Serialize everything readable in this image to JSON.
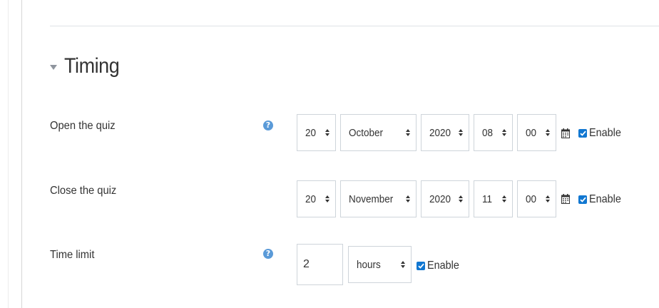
{
  "section": {
    "title": "Timing"
  },
  "open": {
    "label": "Open the quiz",
    "day": "20",
    "month": "October",
    "year": "2020",
    "hour": "08",
    "minute": "00",
    "enable_label": "Enable",
    "enabled": true
  },
  "close": {
    "label": "Close the quiz",
    "day": "20",
    "month": "November",
    "year": "2020",
    "hour": "11",
    "minute": "00",
    "enable_label": "Enable",
    "enabled": true
  },
  "timelimit": {
    "label": "Time limit",
    "value": "2",
    "unit": "hours",
    "enable_label": "Enable",
    "enabled": true
  },
  "icons": {
    "help": "help-icon",
    "calendar": "calendar-icon",
    "caret": "caret-down-icon"
  },
  "colors": {
    "checkbox": "#1177d1",
    "help": "#5a9ad8"
  }
}
